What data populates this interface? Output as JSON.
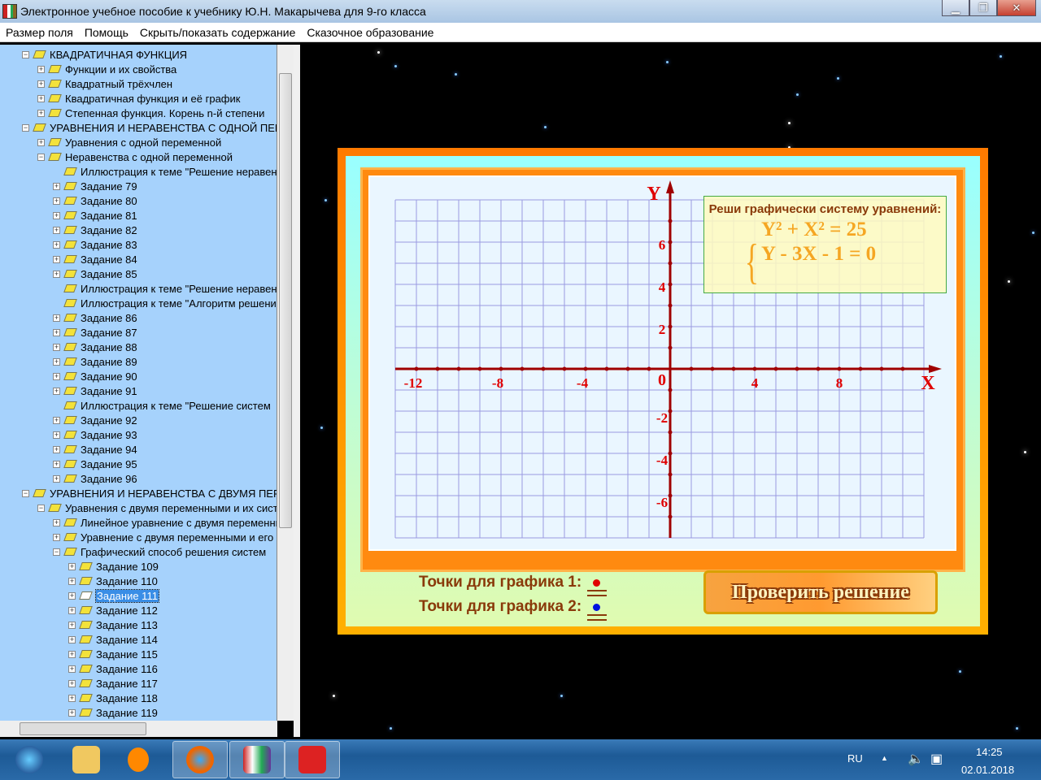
{
  "window": {
    "title": "Электронное учебное пособие к учебнику Ю.Н. Макарычева для 9-го класса",
    "min": "▁",
    "max": "❐",
    "close": "✕"
  },
  "menu": [
    "Размер поля",
    "Помощь",
    "Скрыть/показать содержание",
    "Сказочное образование"
  ],
  "tree": [
    {
      "label": "КВАДРАТИЧНАЯ ФУНКЦИЯ",
      "level": 0,
      "exp": "−"
    },
    {
      "label": "Функции и их свойства",
      "level": 1,
      "exp": "+"
    },
    {
      "label": "Квадратный трёхчлен",
      "level": 1,
      "exp": "+"
    },
    {
      "label": "Квадратичная функция и её график",
      "level": 1,
      "exp": "+"
    },
    {
      "label": "Степенная функция. Корень n-й степени",
      "level": 1,
      "exp": "+"
    },
    {
      "label": "УРАВНЕНИЯ И НЕРАВЕНСТВА С ОДНОЙ ПЕРЕМЕННОЙ",
      "level": 0,
      "exp": "−"
    },
    {
      "label": "Уравнения с одной переменной",
      "level": 1,
      "exp": "+"
    },
    {
      "label": "Неравенства с одной переменной",
      "level": 1,
      "exp": "−"
    },
    {
      "label": "Иллюстрация к теме \"Решение неравенств",
      "level": 2,
      "exp": ""
    },
    {
      "label": "Задание 79",
      "level": 2,
      "exp": "+"
    },
    {
      "label": "Задание 80",
      "level": 2,
      "exp": "+"
    },
    {
      "label": "Задание 81",
      "level": 2,
      "exp": "+"
    },
    {
      "label": "Задание 82",
      "level": 2,
      "exp": "+"
    },
    {
      "label": "Задание 83",
      "level": 2,
      "exp": "+"
    },
    {
      "label": "Задание 84",
      "level": 2,
      "exp": "+"
    },
    {
      "label": "Задание 85",
      "level": 2,
      "exp": "+"
    },
    {
      "label": "Иллюстрация к теме \"Решение неравенств",
      "level": 2,
      "exp": ""
    },
    {
      "label": "Иллюстрация к теме \"Алгоритм решения",
      "level": 2,
      "exp": ""
    },
    {
      "label": "Задание 86",
      "level": 2,
      "exp": "+"
    },
    {
      "label": "Задание 87",
      "level": 2,
      "exp": "+"
    },
    {
      "label": "Задание 88",
      "level": 2,
      "exp": "+"
    },
    {
      "label": "Задание 89",
      "level": 2,
      "exp": "+"
    },
    {
      "label": "Задание 90",
      "level": 2,
      "exp": "+"
    },
    {
      "label": "Задание 91",
      "level": 2,
      "exp": "+"
    },
    {
      "label": "Иллюстрация к теме \"Решение систем",
      "level": 2,
      "exp": ""
    },
    {
      "label": "Задание 92",
      "level": 2,
      "exp": "+"
    },
    {
      "label": "Задание 93",
      "level": 2,
      "exp": "+"
    },
    {
      "label": "Задание 94",
      "level": 2,
      "exp": "+"
    },
    {
      "label": "Задание 95",
      "level": 2,
      "exp": "+"
    },
    {
      "label": "Задание 96",
      "level": 2,
      "exp": "+"
    },
    {
      "label": "УРАВНЕНИЯ И НЕРАВЕНСТВА С ДВУМЯ ПЕРЕМЕННЫМИ",
      "level": 0,
      "exp": "−"
    },
    {
      "label": "Уравнения с двумя переменными и их системы",
      "level": 1,
      "exp": "−"
    },
    {
      "label": "Линейное уравнение с двумя переменными",
      "level": 2,
      "exp": "+"
    },
    {
      "label": "Уравнение с двумя переменными и его график",
      "level": 2,
      "exp": "+"
    },
    {
      "label": "Графический способ решения систем",
      "level": 2,
      "exp": "−"
    },
    {
      "label": "Задание 109",
      "level": 3,
      "exp": "+"
    },
    {
      "label": "Задание 110",
      "level": 3,
      "exp": "+"
    },
    {
      "label": "Задание 111",
      "level": 3,
      "exp": "+",
      "selected": true
    },
    {
      "label": "Задание 112",
      "level": 3,
      "exp": "+"
    },
    {
      "label": "Задание 113",
      "level": 3,
      "exp": "+"
    },
    {
      "label": "Задание 114",
      "level": 3,
      "exp": "+"
    },
    {
      "label": "Задание 115",
      "level": 3,
      "exp": "+"
    },
    {
      "label": "Задание 116",
      "level": 3,
      "exp": "+"
    },
    {
      "label": "Задание 117",
      "level": 3,
      "exp": "+"
    },
    {
      "label": "Задание 118",
      "level": 3,
      "exp": "+"
    },
    {
      "label": "Задание 119",
      "level": 3,
      "exp": "+"
    }
  ],
  "graph": {
    "x_label": "X",
    "y_label": "Y",
    "origin": "0",
    "x_ticks": [
      -12,
      -8,
      -4,
      4,
      8
    ],
    "y_ticks": [
      6,
      4,
      2,
      -2,
      -4,
      -6
    ],
    "xlim": [
      -13,
      12
    ],
    "ylim": [
      -8,
      8
    ]
  },
  "task": {
    "heading": "Реши графически систему уравнений:",
    "eq1": "Y² + X² = 25",
    "eq2": "Y - 3X - 1 = 0"
  },
  "points1": "Точки для графика 1:",
  "points2": "Точки для графика 2:",
  "colors": {
    "dot1": "#e00000",
    "dot2": "#0010e0",
    "axis": "#a00000",
    "grid": "#9a9ae0"
  },
  "check_button": "Проверить решение",
  "taskbar": {
    "lang": "RU",
    "time": "14:25",
    "date": "02.01.2018"
  }
}
